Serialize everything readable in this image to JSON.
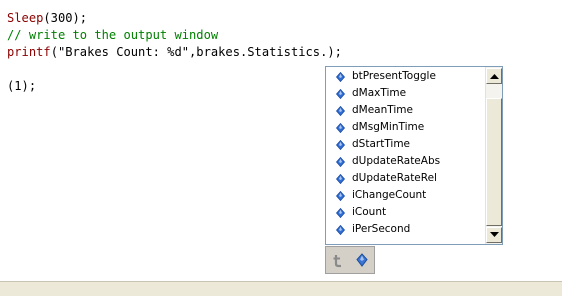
{
  "editor": {
    "line1": {
      "fn": "Sleep",
      "rest": "(300);"
    },
    "line2": {
      "comment": "// write to the output window"
    },
    "line3": {
      "fn": "printf",
      "rest": "(\"Brakes Count: %d\",brakes.Statistics.);"
    },
    "line5": {
      "text": "(1);"
    }
  },
  "autocomplete": {
    "items": [
      {
        "label": "btPresentToggle",
        "icon": "property-icon"
      },
      {
        "label": "dMaxTime",
        "icon": "property-icon"
      },
      {
        "label": "dMeanTime",
        "icon": "property-icon"
      },
      {
        "label": "dMsgMinTime",
        "icon": "property-icon"
      },
      {
        "label": "dStartTime",
        "icon": "property-icon"
      },
      {
        "label": "dUpdateRateAbs",
        "icon": "property-icon"
      },
      {
        "label": "dUpdateRateRel",
        "icon": "property-icon"
      },
      {
        "label": "iChangeCount",
        "icon": "property-icon"
      },
      {
        "label": "iCount",
        "icon": "property-icon"
      },
      {
        "label": "iPerSecond",
        "icon": "property-icon"
      }
    ],
    "filters": [
      {
        "icon": "type-filter-icon"
      },
      {
        "icon": "member-filter-icon"
      }
    ]
  },
  "colors": {
    "function": "#8b0000",
    "comment": "#008000",
    "text": "#000000",
    "icon_blue": "#2f6fd6",
    "popup_border": "#7f9db9"
  }
}
